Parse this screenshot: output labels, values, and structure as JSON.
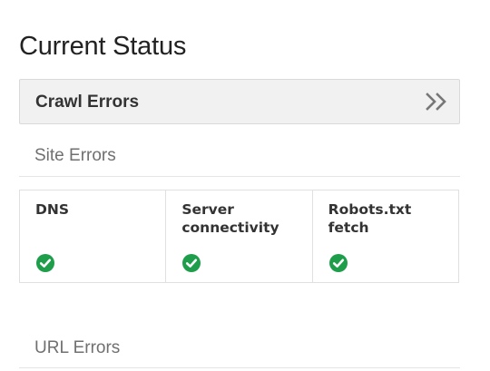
{
  "page": {
    "title": "Current Status"
  },
  "crawl_errors": {
    "header_label": "Crawl Errors",
    "expand_icon": "double-chevron-right-icon",
    "site_errors_label": "Site Errors",
    "site_errors": [
      {
        "label": "DNS",
        "status": "ok",
        "status_icon": "check-circle-icon"
      },
      {
        "label": "Server connectivity",
        "status": "ok",
        "status_icon": "check-circle-icon"
      },
      {
        "label": "Robots.txt fetch",
        "status": "ok",
        "status_icon": "check-circle-icon"
      }
    ],
    "url_errors_label": "URL Errors"
  },
  "colors": {
    "ok_green": "#1e9e4b",
    "header_bg": "#f1f1f1"
  }
}
